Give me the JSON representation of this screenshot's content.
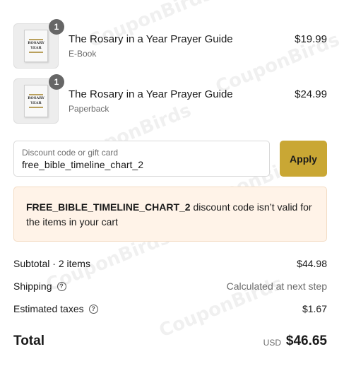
{
  "watermark_text": "CouponBirds",
  "items": [
    {
      "title": "The Rosary in a Year Prayer Guide",
      "variant": "E-Book",
      "price": "$19.99",
      "quantity": "1",
      "cover": {
        "line1": "ROSARY",
        "line2": "YEAR"
      }
    },
    {
      "title": "The Rosary in a Year Prayer Guide",
      "variant": "Paperback",
      "price": "$24.99",
      "quantity": "1",
      "cover": {
        "line1": "ROSARY",
        "line2": "YEAR"
      }
    }
  ],
  "discount": {
    "label": "Discount code or gift card",
    "value": "free_bible_timeline_chart_2",
    "apply_label": "Apply"
  },
  "error": {
    "code": "FREE_BIBLE_TIMELINE_CHART_2",
    "message": " discount code isn’t valid for the items in your cart"
  },
  "summary": {
    "subtotal_label": "Subtotal · 2 items",
    "subtotal_value": "$44.98",
    "shipping_label": "Shipping",
    "shipping_value": "Calculated at next step",
    "taxes_label": "Estimated taxes",
    "taxes_value": "$1.67",
    "help_glyph": "?"
  },
  "total": {
    "label": "Total",
    "currency": "USD",
    "value": "$46.65"
  },
  "colors": {
    "apply_button": "#c9a734",
    "error_background": "#fff3e8",
    "quantity_badge": "#666666"
  }
}
